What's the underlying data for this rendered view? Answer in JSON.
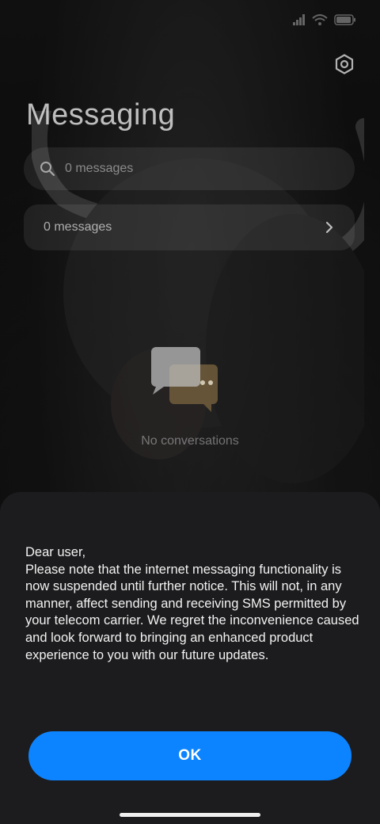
{
  "app": {
    "title": "Messaging"
  },
  "icons": {
    "settings": "gear-icon",
    "search": "search-icon",
    "chevron": "chevron-right-icon",
    "empty": "chat-bubbles-icon",
    "signal": "signal-icon",
    "wifi": "wifi-icon",
    "battery": "battery-icon"
  },
  "search": {
    "text": "0 messages"
  },
  "summary_row": {
    "label": "0 messages"
  },
  "empty_state": {
    "text": "No conversations"
  },
  "dialog": {
    "message": "Dear user,\nPlease note that the internet messaging functionality is now suspended until further notice. This will not, in any manner, affect sending and receiving SMS permitted by your telecom carrier. We regret the inconvenience caused and look forward to bringing an enhanced product experience to you with our future updates.",
    "ok_label": "OK"
  },
  "colors": {
    "accent": "#0d84ff",
    "sheet": "#1c1c1e"
  }
}
